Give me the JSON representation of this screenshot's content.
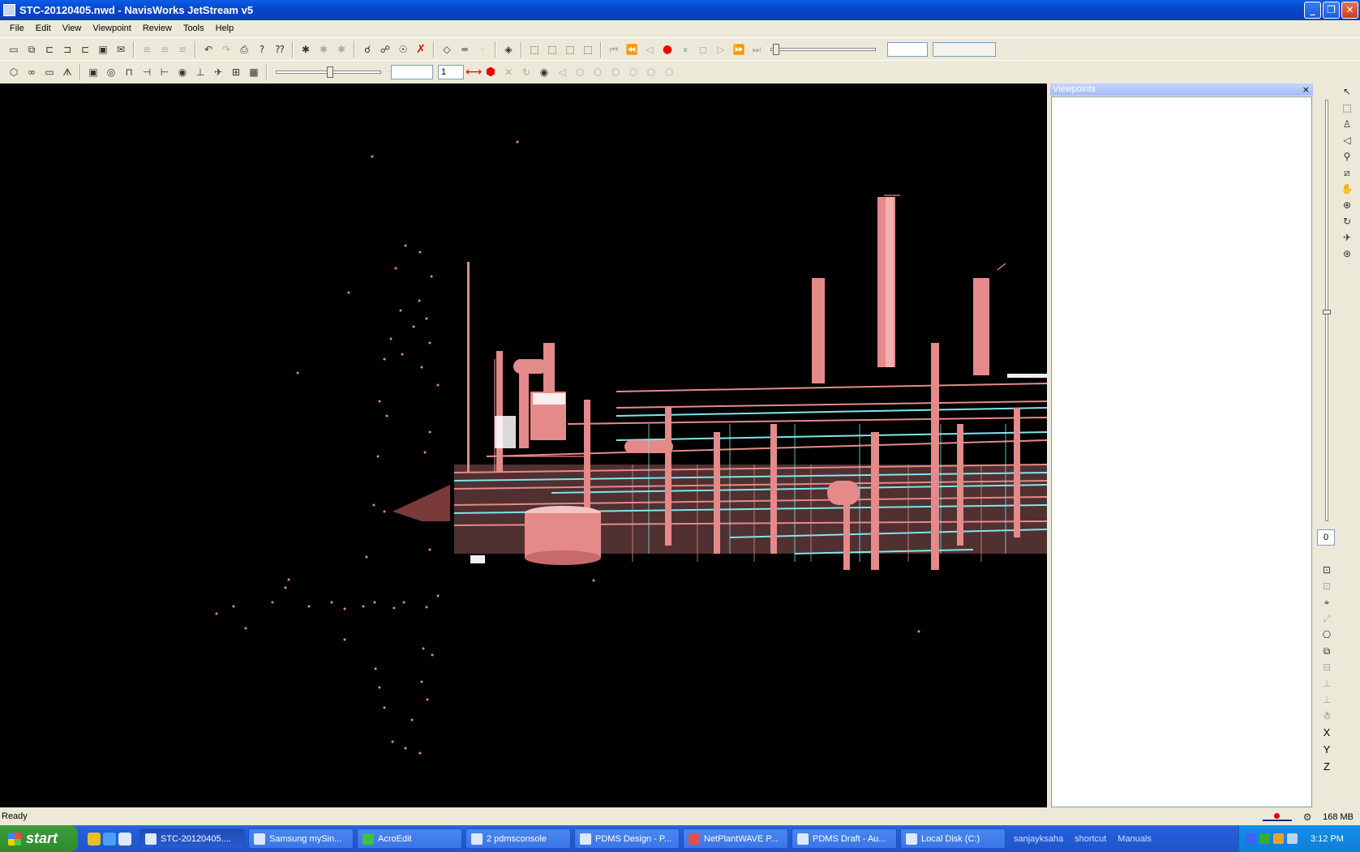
{
  "window": {
    "title": "STC-20120405.nwd - NavisWorks JetStream v5"
  },
  "menu": [
    "File",
    "Edit",
    "View",
    "Viewpoint",
    "Review",
    "Tools",
    "Help"
  ],
  "toolbar2": {
    "section_value": "1"
  },
  "viewpoints_panel": {
    "title": "Viewpoints",
    "close": "×"
  },
  "right_strip": {
    "zoom_value": "0",
    "axes": [
      "X",
      "Y",
      "Z"
    ]
  },
  "status": {
    "text": "Ready",
    "memory": "168 MB"
  },
  "taskbar": {
    "start": "start",
    "tasks": [
      {
        "label": "STC-20120405....",
        "active": true
      },
      {
        "label": "Samsung mySin..."
      },
      {
        "label": "AcroEdit"
      },
      {
        "label": "2 pdmsconsole"
      },
      {
        "label": "PDMS Design - P..."
      },
      {
        "label": "NetPlantWAVE P..."
      },
      {
        "label": "PDMS Draft - Au..."
      },
      {
        "label": "Local Disk (C:)"
      }
    ],
    "toolbars": [
      "sanjayksaha",
      "shortcut",
      "Manuals"
    ],
    "clock": "3:12 PM"
  },
  "colors": {
    "model_salmon": "#e48a8a",
    "model_cyan": "#7fe6ea",
    "viewport_bg": "#000000"
  }
}
